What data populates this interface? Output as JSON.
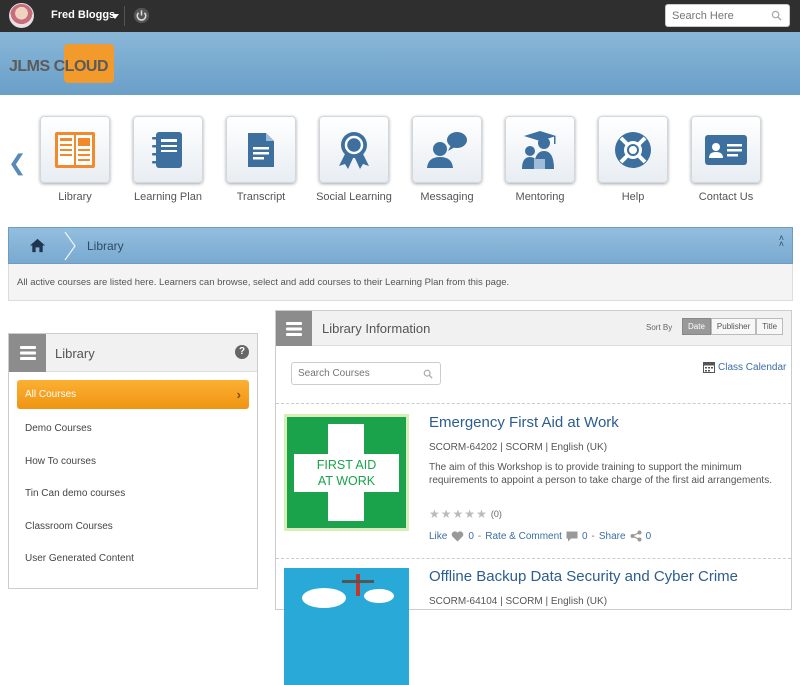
{
  "topbar": {
    "username": "Fred Bloggs",
    "search_placeholder": "Search Here"
  },
  "brand": {
    "logo_text": "JLMS CLOUD",
    "accent_color": "#f39a2c",
    "banner_color": "#7aaed3"
  },
  "nav": {
    "items": [
      {
        "label": "Library",
        "icon": "library-icon"
      },
      {
        "label": "Learning Plan",
        "icon": "notebook-icon"
      },
      {
        "label": "Transcript",
        "icon": "document-icon"
      },
      {
        "label": "Social Learning",
        "icon": "award-ribbon-icon"
      },
      {
        "label": "Messaging",
        "icon": "chat-person-icon"
      },
      {
        "label": "Mentoring",
        "icon": "mentor-icon"
      },
      {
        "label": "Help",
        "icon": "lifebuoy-icon"
      },
      {
        "label": "Contact Us",
        "icon": "id-card-icon"
      }
    ]
  },
  "breadcrumb": {
    "current": "Library"
  },
  "notice": "All active courses are listed here. Learners can browse, select and add courses to their Learning Plan from this page.",
  "library_panel": {
    "title": "Library",
    "items": [
      "All Courses",
      "Demo Courses",
      "How To courses",
      "Tin Can demo courses",
      "Classroom Courses",
      "User Generated Content"
    ],
    "active_index": 0
  },
  "info_panel": {
    "title": "Library Information",
    "sort_label": "Sort By",
    "sort_options": [
      "Date",
      "Publisher",
      "Title"
    ],
    "sort_active": "Date",
    "search_placeholder": "Search Courses",
    "calendar_label": "Class Calendar"
  },
  "courses": [
    {
      "title": "Emergency First Aid at Work",
      "meta": "SCORM-64202 | SCORM | English (UK)",
      "description": "The aim of this Workshop is to provide training to support the minimum requirements to appoint a person to take charge of the first aid arrangements.",
      "thumb_text_1": "FIRST AID",
      "thumb_text_2": "AT WORK",
      "rating_count": "(0)",
      "rating_stars": 0,
      "like_label": "Like",
      "like_count": "0",
      "rate_label": "Rate & Comment",
      "comment_count": "0",
      "share_label": "Share",
      "share_count": "0",
      "sep": "-"
    },
    {
      "title": "Offline Backup Data Security and Cyber Crime",
      "meta": "SCORM-64104 | SCORM | English (UK)"
    }
  ]
}
